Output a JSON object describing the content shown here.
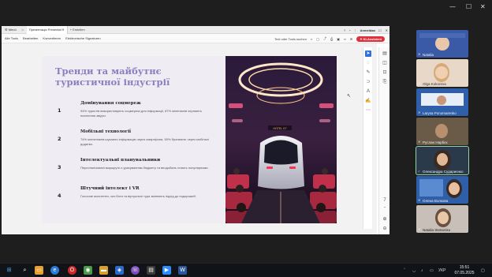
{
  "viewer": {
    "tabbar": {
      "menu": "Menü",
      "tab_title": "Презентація Presentation",
      "new_tab": "Erstellen",
      "login": "Anmelden"
    },
    "menu": [
      "Alle Tools",
      "Bearbeiten",
      "Konvertieren",
      "Elektronische Signaturen"
    ],
    "search": "Text oder Tools suchen",
    "ai_button": "KI-Assistent"
  },
  "slide": {
    "title": "Тренди та майбутнє туристичної індустрії",
    "items": [
      {
        "num": "1",
        "heading": "Домінування соцмереж",
        "text": "94% туристів використовують соцмережі для інформації, 87% міленіалів черпають натхнення звідти."
      },
      {
        "num": "2",
        "heading": "Мобільні технології",
        "text": "74% мілленіалів шукають інформацію через смартфони, 50% бронюють через мобільні додатки."
      },
      {
        "num": "3",
        "heading": "Інтелектуальні планувальники",
        "text": "Персоналізовані маршрути з урахуванням бюджету та вподобань стають популярними."
      },
      {
        "num": "4",
        "heading": "Штучний інтелект і VR",
        "text": "Голосові асистенти, чат-боти та віртуальні тури змінюють підхід до подорожей."
      }
    ],
    "photo_sign": "HOTEL 07"
  },
  "participants": [
    {
      "name": "Natalia",
      "bg": "#3a5aa8"
    },
    {
      "name": "Olga Kokoreva",
      "bg": "#e8d8c8"
    },
    {
      "name": "Larysa Ponomarenko",
      "bg": "#2f5fa8"
    },
    {
      "name": "Руслан Нарбєк",
      "bg": "#4a4030"
    },
    {
      "name": "Олександра Судариєнко",
      "bg": "#2a3a4a"
    },
    {
      "name": "Олена Волкова",
      "bg": "#2f5fa8"
    },
    {
      "name": "Natalia Stetsenko",
      "bg": "#c8c0b8"
    }
  ],
  "taskbar": {
    "time": "15:51",
    "date": "07.05.2025",
    "lang": "УКР"
  },
  "colors": {
    "accent_title": "#8a7fbf",
    "ai_button": "#e0303b",
    "slide_bg": "#efecf4"
  }
}
